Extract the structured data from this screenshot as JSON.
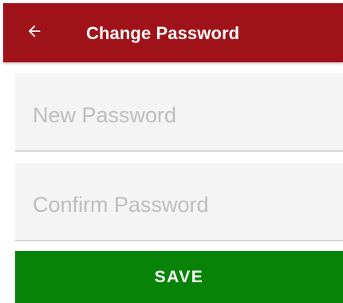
{
  "colors": {
    "app_bar": "#a01219",
    "save_button": "#078407",
    "field_background": "#f4f4f4",
    "placeholder": "#bdbdbd"
  },
  "header": {
    "back_icon": "arrow-left-icon",
    "title": "Change Password"
  },
  "form": {
    "new_password": {
      "placeholder": "New Password",
      "value": ""
    },
    "confirm_password": {
      "placeholder": "Confirm Password",
      "value": ""
    },
    "save_label": "SAVE"
  }
}
